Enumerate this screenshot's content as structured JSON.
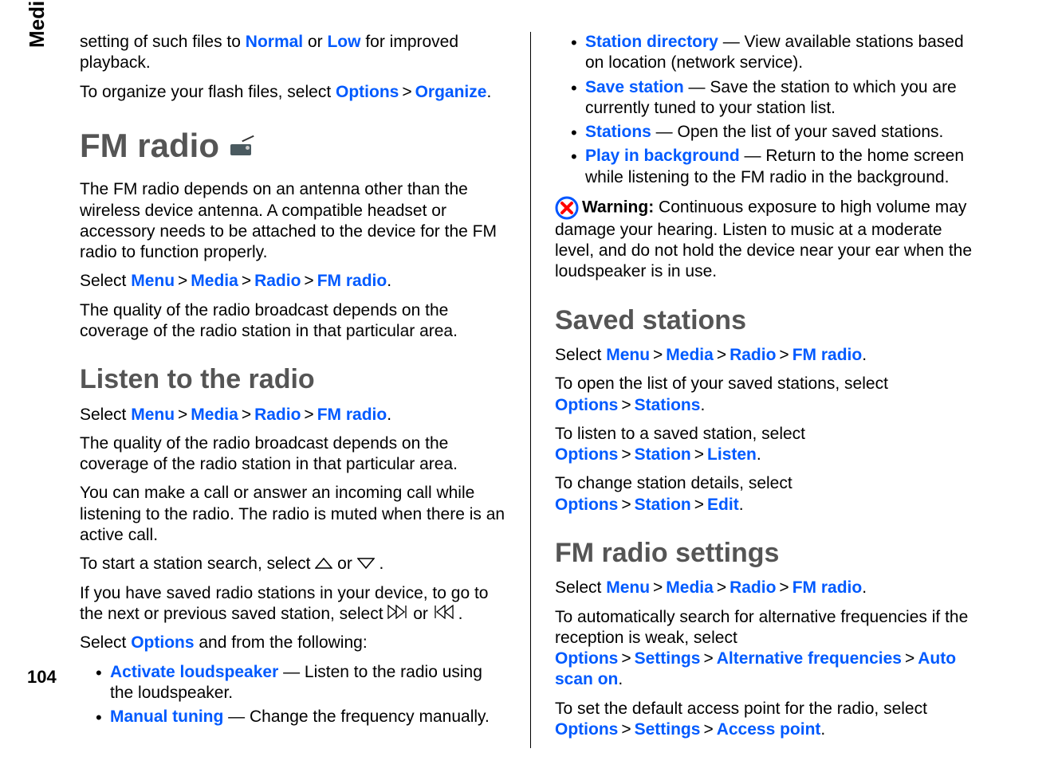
{
  "side_label": "Media",
  "page_number": "104",
  "left": {
    "intro_p1_a": "setting of such files to ",
    "intro_normal": "Normal",
    "intro_p1_b": " or ",
    "intro_low": "Low",
    "intro_p1_c": " for improved playback.",
    "intro_p2_a": "To organize your flash files, select ",
    "intro_options": "Options",
    "intro_p2_b": "Organize",
    "intro_p2_c": ".",
    "h1": "FM radio",
    "p3": "The FM radio depends on an antenna other than the wireless device antenna. A compatible headset or accessory needs to be attached to the device for the FM radio to function properly.",
    "nav1_prefix": "Select ",
    "nav_menu": "Menu",
    "nav_media": "Media",
    "nav_radio": "Radio",
    "nav_fm": "FM radio",
    "p4": "The quality of the radio broadcast depends on the coverage of the radio station in that particular area.",
    "h2_listen": "Listen to the radio",
    "listen_nav_prefix": "Select ",
    "p5": "The quality of the radio broadcast depends on the coverage of the radio station in that particular area.",
    "p6": "You can make a call or answer an incoming call while listening to the radio. The radio is muted when there is an active call.",
    "p7_a": "To start a station search, select ",
    "p7_b": " or ",
    "p7_c": ".",
    "p8_a": "If you have saved radio stations in your device, to go to the next or previous saved station, select ",
    "p8_b": " or ",
    "p8_c": ".",
    "p9_a": "Select ",
    "p9_options": "Options",
    "p9_b": " and from the following:",
    "li1_kw": "Activate loudspeaker",
    "li1_txt": "  — Listen to the radio using the loudspeaker.",
    "li2_kw": "Manual tuning",
    "li2_txt": "  — Change the frequency manually."
  },
  "right": {
    "li1_kw": "Station directory",
    "li1_txt": "  — View available stations based on location (network service).",
    "li2_kw": "Save station",
    "li2_txt": "  — Save the station to which you are currently tuned to your station list.",
    "li3_kw": "Stations",
    "li3_txt": "  — Open the list of your saved stations.",
    "li4_kw": "Play in background",
    "li4_txt": "  — Return to the home screen while listening to the FM radio in the background.",
    "warn_label": "Warning: ",
    "warn_txt": " Continuous exposure to high volume may damage your hearing. Listen to music at a moderate level, and do not hold the device near your ear when the loudspeaker is in use.",
    "h2_saved": "Saved stations",
    "saved_nav_prefix": "Select ",
    "saved_p1_a": "To open the list of your saved stations, select ",
    "saved_options": "Options",
    "saved_stations": "Stations",
    "saved_p2_a": "To listen to a saved station, select ",
    "saved_station": "Station",
    "saved_listen": "Listen",
    "saved_p3_a": "To change station details, select ",
    "saved_edit": "Edit",
    "h2_settings": "FM radio settings",
    "settings_nav_prefix": "Select ",
    "settings_p1_a": "To automatically search for alternative frequencies if the reception is weak, select ",
    "settings_options": "Options",
    "settings_settings": "Settings",
    "settings_altfreq": "Alternative frequencies",
    "settings_autoscan": "Auto scan on",
    "settings_p2_a": "To set the default access point for the radio, select ",
    "settings_access": "Access point"
  },
  "sep": ">"
}
